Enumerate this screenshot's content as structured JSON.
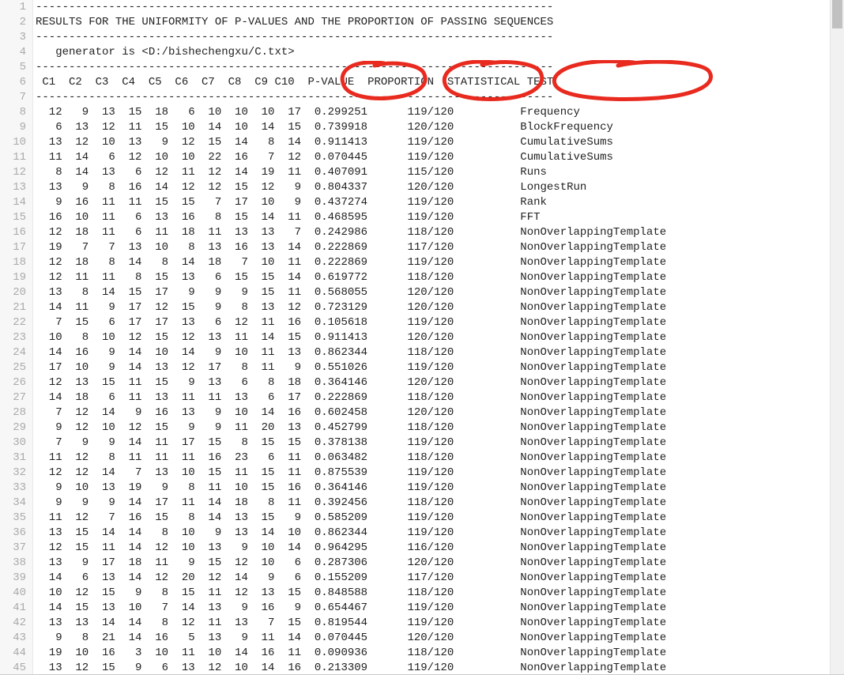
{
  "title_line": "RESULTS FOR THE UNIFORMITY OF P-VALUES AND THE PROPORTION OF PASSING SEQUENCES",
  "generator_line": "   generator is <D:/bishechengxu/C.txt>",
  "sep": "------------------------------------------------------------------------------",
  "header_raw": " C1  C2  C3  C4  C5  C6  C7  C8  C9 C10  P-VALUE  PROPORTION  STATISTICAL TEST",
  "headers": {
    "pvalue": "P-VALUE",
    "proportion": "PROPORTION",
    "stat_test": "STATISTICAL TEST"
  },
  "lines": {
    "start": 1,
    "end": 45
  },
  "rows": [
    {
      "c": [
        12,
        9,
        13,
        15,
        18,
        6,
        10,
        10,
        10,
        17
      ],
      "p": "0.299251",
      "prop": "119/120",
      "test": "Frequency"
    },
    {
      "c": [
        6,
        13,
        12,
        11,
        15,
        10,
        14,
        10,
        14,
        15
      ],
      "p": "0.739918",
      "prop": "120/120",
      "test": "BlockFrequency"
    },
    {
      "c": [
        13,
        12,
        10,
        13,
        9,
        12,
        15,
        14,
        8,
        14
      ],
      "p": "0.911413",
      "prop": "119/120",
      "test": "CumulativeSums"
    },
    {
      "c": [
        11,
        14,
        6,
        12,
        10,
        10,
        22,
        16,
        7,
        12
      ],
      "p": "0.070445",
      "prop": "119/120",
      "test": "CumulativeSums"
    },
    {
      "c": [
        8,
        14,
        13,
        6,
        12,
        11,
        12,
        14,
        19,
        11
      ],
      "p": "0.407091",
      "prop": "115/120",
      "test": "Runs"
    },
    {
      "c": [
        13,
        9,
        8,
        16,
        14,
        12,
        12,
        15,
        12,
        9
      ],
      "p": "0.804337",
      "prop": "120/120",
      "test": "LongestRun"
    },
    {
      "c": [
        9,
        16,
        11,
        11,
        15,
        15,
        7,
        17,
        10,
        9
      ],
      "p": "0.437274",
      "prop": "119/120",
      "test": "Rank"
    },
    {
      "c": [
        16,
        10,
        11,
        6,
        13,
        16,
        8,
        15,
        14,
        11
      ],
      "p": "0.468595",
      "prop": "119/120",
      "test": "FFT"
    },
    {
      "c": [
        12,
        18,
        11,
        6,
        11,
        18,
        11,
        13,
        13,
        7
      ],
      "p": "0.242986",
      "prop": "118/120",
      "test": "NonOverlappingTemplate"
    },
    {
      "c": [
        19,
        7,
        7,
        13,
        10,
        8,
        13,
        16,
        13,
        14
      ],
      "p": "0.222869",
      "prop": "117/120",
      "test": "NonOverlappingTemplate"
    },
    {
      "c": [
        12,
        18,
        8,
        14,
        8,
        14,
        18,
        7,
        10,
        11
      ],
      "p": "0.222869",
      "prop": "119/120",
      "test": "NonOverlappingTemplate"
    },
    {
      "c": [
        12,
        11,
        11,
        8,
        15,
        13,
        6,
        15,
        15,
        14
      ],
      "p": "0.619772",
      "prop": "118/120",
      "test": "NonOverlappingTemplate"
    },
    {
      "c": [
        13,
        8,
        14,
        15,
        17,
        9,
        9,
        9,
        15,
        11
      ],
      "p": "0.568055",
      "prop": "120/120",
      "test": "NonOverlappingTemplate"
    },
    {
      "c": [
        14,
        11,
        9,
        17,
        12,
        15,
        9,
        8,
        13,
        12
      ],
      "p": "0.723129",
      "prop": "120/120",
      "test": "NonOverlappingTemplate"
    },
    {
      "c": [
        7,
        15,
        6,
        17,
        17,
        13,
        6,
        12,
        11,
        16
      ],
      "p": "0.105618",
      "prop": "119/120",
      "test": "NonOverlappingTemplate"
    },
    {
      "c": [
        10,
        8,
        10,
        12,
        15,
        12,
        13,
        11,
        14,
        15
      ],
      "p": "0.911413",
      "prop": "120/120",
      "test": "NonOverlappingTemplate"
    },
    {
      "c": [
        14,
        16,
        9,
        14,
        10,
        14,
        9,
        10,
        11,
        13
      ],
      "p": "0.862344",
      "prop": "118/120",
      "test": "NonOverlappingTemplate"
    },
    {
      "c": [
        17,
        10,
        9,
        14,
        13,
        12,
        17,
        8,
        11,
        9
      ],
      "p": "0.551026",
      "prop": "119/120",
      "test": "NonOverlappingTemplate"
    },
    {
      "c": [
        12,
        13,
        15,
        11,
        15,
        9,
        13,
        6,
        8,
        18
      ],
      "p": "0.364146",
      "prop": "120/120",
      "test": "NonOverlappingTemplate"
    },
    {
      "c": [
        14,
        18,
        6,
        11,
        13,
        11,
        11,
        13,
        6,
        17
      ],
      "p": "0.222869",
      "prop": "118/120",
      "test": "NonOverlappingTemplate"
    },
    {
      "c": [
        7,
        12,
        14,
        9,
        16,
        13,
        9,
        10,
        14,
        16
      ],
      "p": "0.602458",
      "prop": "120/120",
      "test": "NonOverlappingTemplate"
    },
    {
      "c": [
        9,
        12,
        10,
        12,
        15,
        9,
        9,
        11,
        20,
        13
      ],
      "p": "0.452799",
      "prop": "118/120",
      "test": "NonOverlappingTemplate"
    },
    {
      "c": [
        7,
        9,
        9,
        14,
        11,
        17,
        15,
        8,
        15,
        15
      ],
      "p": "0.378138",
      "prop": "119/120",
      "test": "NonOverlappingTemplate"
    },
    {
      "c": [
        11,
        12,
        8,
        11,
        11,
        11,
        16,
        23,
        6,
        11
      ],
      "p": "0.063482",
      "prop": "118/120",
      "test": "NonOverlappingTemplate"
    },
    {
      "c": [
        12,
        12,
        14,
        7,
        13,
        10,
        15,
        11,
        15,
        11
      ],
      "p": "0.875539",
      "prop": "119/120",
      "test": "NonOverlappingTemplate"
    },
    {
      "c": [
        9,
        10,
        13,
        19,
        9,
        8,
        11,
        10,
        15,
        16
      ],
      "p": "0.364146",
      "prop": "119/120",
      "test": "NonOverlappingTemplate"
    },
    {
      "c": [
        9,
        9,
        9,
        14,
        17,
        11,
        14,
        18,
        8,
        11
      ],
      "p": "0.392456",
      "prop": "118/120",
      "test": "NonOverlappingTemplate"
    },
    {
      "c": [
        11,
        12,
        7,
        16,
        15,
        8,
        14,
        13,
        15,
        9
      ],
      "p": "0.585209",
      "prop": "119/120",
      "test": "NonOverlappingTemplate"
    },
    {
      "c": [
        13,
        15,
        14,
        14,
        8,
        10,
        9,
        13,
        14,
        10
      ],
      "p": "0.862344",
      "prop": "119/120",
      "test": "NonOverlappingTemplate"
    },
    {
      "c": [
        12,
        15,
        11,
        14,
        12,
        10,
        13,
        9,
        10,
        14
      ],
      "p": "0.964295",
      "prop": "116/120",
      "test": "NonOverlappingTemplate"
    },
    {
      "c": [
        13,
        9,
        17,
        18,
        11,
        9,
        15,
        12,
        10,
        6
      ],
      "p": "0.287306",
      "prop": "120/120",
      "test": "NonOverlappingTemplate"
    },
    {
      "c": [
        14,
        6,
        13,
        14,
        12,
        20,
        12,
        14,
        9,
        6
      ],
      "p": "0.155209",
      "prop": "117/120",
      "test": "NonOverlappingTemplate"
    },
    {
      "c": [
        10,
        12,
        15,
        9,
        8,
        15,
        11,
        12,
        13,
        15
      ],
      "p": "0.848588",
      "prop": "118/120",
      "test": "NonOverlappingTemplate"
    },
    {
      "c": [
        14,
        15,
        13,
        10,
        7,
        14,
        13,
        9,
        16,
        9
      ],
      "p": "0.654467",
      "prop": "119/120",
      "test": "NonOverlappingTemplate"
    },
    {
      "c": [
        13,
        13,
        14,
        14,
        8,
        12,
        11,
        13,
        7,
        15
      ],
      "p": "0.819544",
      "prop": "119/120",
      "test": "NonOverlappingTemplate"
    },
    {
      "c": [
        9,
        8,
        21,
        14,
        16,
        5,
        13,
        9,
        11,
        14
      ],
      "p": "0.070445",
      "prop": "120/120",
      "test": "NonOverlappingTemplate"
    },
    {
      "c": [
        19,
        10,
        16,
        3,
        10,
        11,
        10,
        14,
        16,
        11
      ],
      "p": "0.090936",
      "prop": "118/120",
      "test": "NonOverlappingTemplate"
    },
    {
      "c": [
        13,
        12,
        15,
        9,
        6,
        13,
        12,
        10,
        14,
        16
      ],
      "p": "0.213309",
      "prop": "119/120",
      "test": "NonOverlappingTemplate"
    }
  ]
}
